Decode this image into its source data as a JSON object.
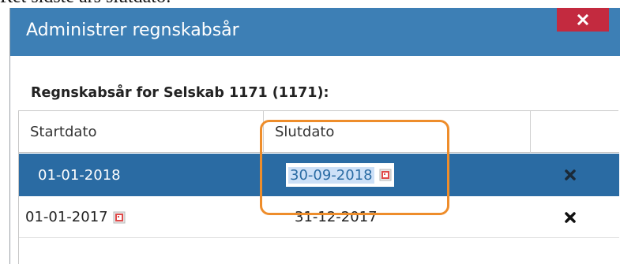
{
  "top_snippet": "Ret sidste års slutdato:",
  "dialog": {
    "title": "Administrer regnskabsår",
    "close_label": "×",
    "section_heading": "Regnskabsår for Selskab 1171 (1171):"
  },
  "grid": {
    "columns": [
      "Startdato",
      "Slutdato",
      ""
    ],
    "rows": [
      {
        "start": "01-01-2018",
        "end": "30-09-2018",
        "selected": true
      },
      {
        "start": "01-01-2017",
        "end": "31-12-2017",
        "selected": false
      }
    ]
  },
  "icons": {
    "close": "close-icon",
    "calendar": "calendar-icon",
    "delete": "delete-icon"
  },
  "colors": {
    "titlebar": "#3d7fb5",
    "close_button": "#c32a3f",
    "selected_row": "#2a6ba3",
    "highlight": "#ee8d2b"
  }
}
